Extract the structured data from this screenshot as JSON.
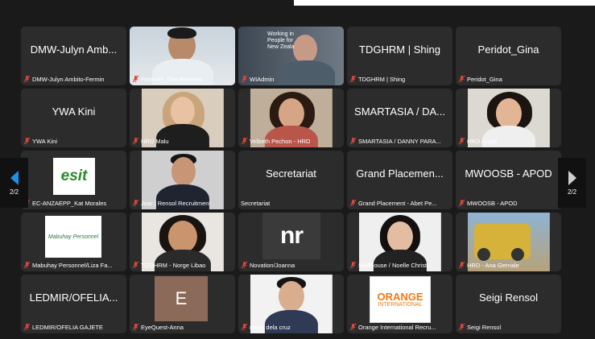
{
  "pagination": {
    "left": "2/2",
    "right": "2/2"
  },
  "tiles": [
    {
      "big": "DMW-Julyn Amb...",
      "label": "DMW-Julyn Ambito-Fermin"
    },
    {
      "big": "",
      "label": "Petro-Fil_Don Bermejo"
    },
    {
      "big": "",
      "label": "WIAdmin",
      "overlay": "Working in\nPeople for\nNew Zeala"
    },
    {
      "big": "TDGHRM | Shing",
      "label": "TDGHRM | Shing"
    },
    {
      "big": "Peridot_Gina",
      "label": "Peridot_Gina"
    },
    {
      "big": "YWA Kini",
      "label": "YWA Kini"
    },
    {
      "big": "",
      "label": "HRD Malu"
    },
    {
      "big": "",
      "label": "Velbeth Pechon - HRD"
    },
    {
      "big": "SMARTASIA / DA...",
      "label": "SMARTASIA / DANNY PARA..."
    },
    {
      "big": "",
      "label": "HRD Angel"
    },
    {
      "big": "",
      "label": "EC-ANZAEPP_Kat Morales",
      "logo": "esit"
    },
    {
      "big": "",
      "label": "Joar | Rensol Recruitment"
    },
    {
      "big": "Secretariat",
      "label": "Secretariat"
    },
    {
      "big": "Grand Placemen...",
      "label": "Grand Placement - Abet Pe..."
    },
    {
      "big": "MWOOSB - APOD",
      "label": "MWOOSB - APOD"
    },
    {
      "big": "",
      "label": "Mabuhay Personnel/Liza Fa...",
      "logo": "Mabuhay Personnel"
    },
    {
      "big": "",
      "label": "TDGHRM - Norge Libao"
    },
    {
      "big": "",
      "label": "Novation/Joanna",
      "logo": "nr"
    },
    {
      "big": "",
      "label": "Staffhouse / Noelle Christi..."
    },
    {
      "big": "",
      "label": "HRD - Ana Gernale"
    },
    {
      "big": "LEDMIR/OFELIA...",
      "label": "LEDMIR/OFELIA GAJETE"
    },
    {
      "big": "",
      "label": "EyeQuest-Anna",
      "logo": "E"
    },
    {
      "big": "",
      "label": "renzy dela cruz"
    },
    {
      "big": "",
      "label": "Orange International Recru...",
      "logo": "ORANGE",
      "logo2": "INTERNATIONAL"
    },
    {
      "big": "Seigi Rensol",
      "label": "Seigi Rensol"
    }
  ],
  "colors": {
    "tile": "#2c2c2c",
    "bg": "#1a1a1a",
    "muted_mic": "#e0453a",
    "nav_arrow": "#1e90e6"
  }
}
